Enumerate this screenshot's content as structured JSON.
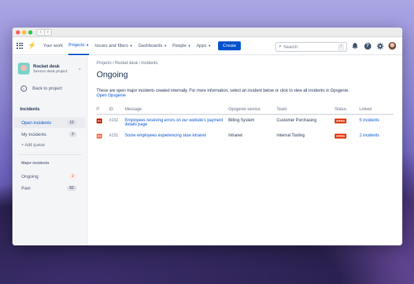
{
  "browser": {
    "nav_back": "‹",
    "nav_forward": "›"
  },
  "topnav": {
    "items": [
      {
        "label": "Your work",
        "active": false,
        "dropdown": false
      },
      {
        "label": "Projects",
        "active": true,
        "dropdown": true
      },
      {
        "label": "Issues and filters",
        "active": false,
        "dropdown": true
      },
      {
        "label": "Dashboards",
        "active": false,
        "dropdown": true
      },
      {
        "label": "People",
        "active": false,
        "dropdown": true
      },
      {
        "label": "Apps",
        "active": false,
        "dropdown": true
      }
    ],
    "create_label": "Create",
    "search_placeholder": "Search",
    "search_shortcut": "/",
    "help_glyph": "?"
  },
  "sidebar": {
    "project_name": "Rocket desk",
    "project_type": "Service desk project",
    "back_label": "Back to project",
    "section_title": "Incidents",
    "queues": [
      {
        "label": "Open incidents",
        "count": "12",
        "active": true
      },
      {
        "label": "My incidents",
        "count": "2",
        "active": false
      }
    ],
    "add_queue": "+ Add queue",
    "sub_title": "Major incidents",
    "major": [
      {
        "label": "Ongoing",
        "count": "2",
        "alert": true
      },
      {
        "label": "Past",
        "count": "62",
        "alert": false
      }
    ]
  },
  "main": {
    "breadcrumb": "Projects / Rocket desk / Incidents",
    "title": "Ongoing",
    "description": "These are open major incidents created internally. For more information, select an incident below or click to view all incidents in Opsgenie.",
    "open_link": "Open Opsgenie",
    "columns": [
      "P",
      "ID",
      "Message",
      "Opsgenie service",
      "Team",
      "Status",
      "Linked"
    ],
    "rows": [
      {
        "priority": "P1",
        "priority_color": "#bf2600",
        "id": "#232",
        "message": "Employees receiving errors on our website's payment details page",
        "service": "Billing System",
        "team": "Customer Purchasing",
        "status": "OPEN",
        "linked": "5 incidents"
      },
      {
        "priority": "P2",
        "priority_color": "#ff7452",
        "id": "#231",
        "message": "Some employees experiencing slow intranet",
        "service": "Intranet",
        "team": "Internal Tooling",
        "status": "OPEN",
        "linked": "2 incidents"
      }
    ]
  }
}
